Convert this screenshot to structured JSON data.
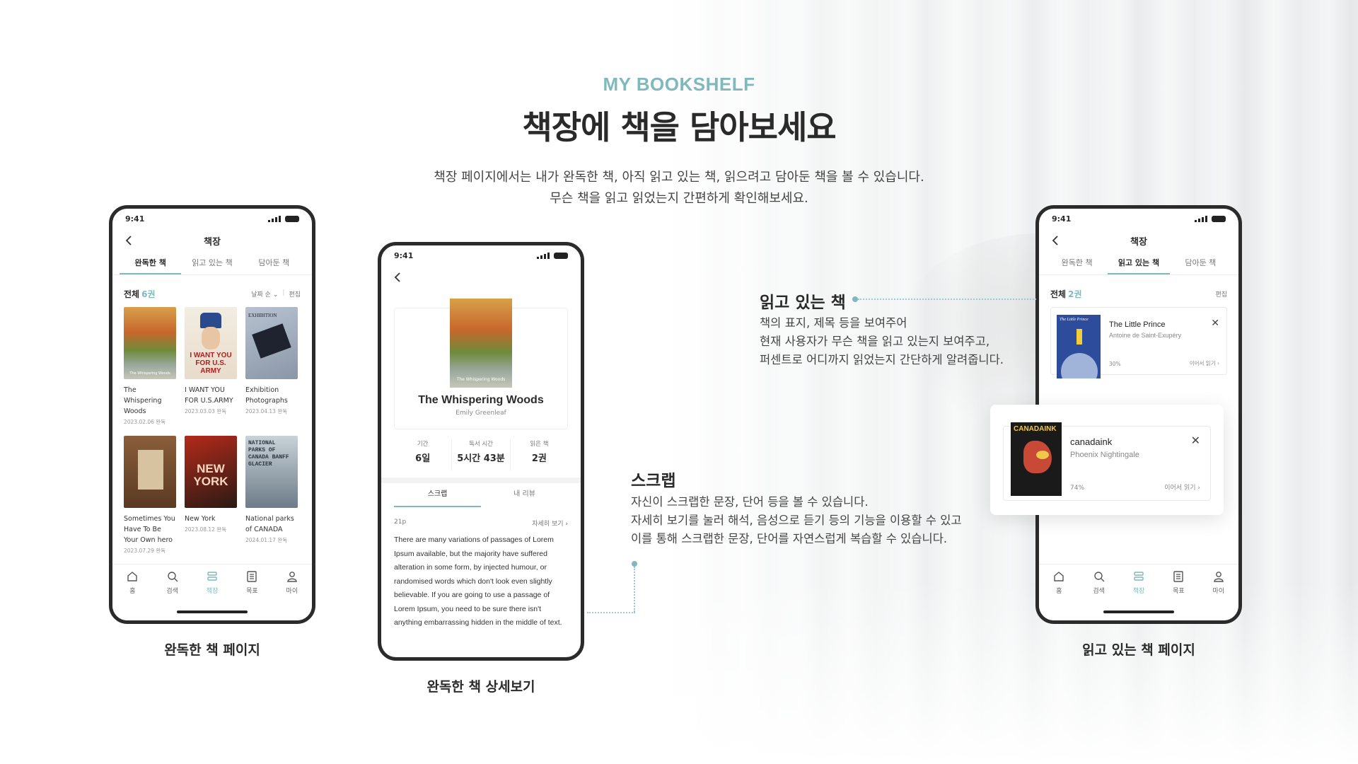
{
  "eyebrow": "MY BOOKSHELF",
  "headline": "책장에 책을 담아보세요",
  "lead": [
    "책장 페이지에서는 내가 완독한 책, 아직 읽고 있는 책, 읽으려고 담아둔 책을 볼 수 있습니다.",
    "무슨 책을 읽고 읽었는지 간편하게 확인해보세요."
  ],
  "accent": "#7fb9bd",
  "status_time": "9:41",
  "shelf": {
    "title": "책장",
    "tabs": [
      "완독한 책",
      "읽고 있는 책",
      "담아둔 책"
    ],
    "total_label": "전체",
    "finished_count": "6권",
    "reading_count": "2권",
    "sort": "날짜 순",
    "edit": "편집"
  },
  "books": [
    {
      "title": "The Whispering Woods",
      "date": "2023.02.06 완독",
      "cover_text": "The Whispering Woods"
    },
    {
      "title": "I WANT YOU FOR U.S.ARMY",
      "date": "2023.03.03 완독",
      "cover_text": "I WANT YOU FOR U.S. ARMY"
    },
    {
      "title": "Exhibition Photographs",
      "date": "2023.04.13 완독",
      "cover_text": "EXHIBITION"
    },
    {
      "title": "Sometimes You Have To Be Your Own hero",
      "date": "2023.07.29 완독",
      "cover_text": ""
    },
    {
      "title": "New York",
      "date": "2023.08.12 완독",
      "cover_text": "NEW YORK"
    },
    {
      "title": "National parks of CANADA",
      "date": "2024.01.17 완독",
      "cover_text": "NATIONAL PARKS OF CANADA BANFF GLACIER"
    }
  ],
  "nav": [
    "홈",
    "검색",
    "책장",
    "목표",
    "마이"
  ],
  "detail": {
    "title": "The Whispering Woods",
    "author": "Emily Greenleaf",
    "stats": [
      {
        "label": "기간",
        "value": "6일"
      },
      {
        "label": "독서 시간",
        "value": "5시간 43분"
      },
      {
        "label": "읽은 책",
        "value": "2권"
      }
    ],
    "tabs": [
      "스크랩",
      "내 리뷰"
    ],
    "page": "21p",
    "more": "자세히 보기",
    "scrap_text": "There are many variations of passages of Lorem Ipsum available, but the majority have suffered alteration in some form, by injected humour, or randomised words which don't look even slightly believable. If you are going to use a passage of Lorem Ipsum, you need to be sure there isn't anything embarrassing hidden in the middle of text."
  },
  "reading": [
    {
      "title": "The Little Prince",
      "author": "Antoine de Saint-Exupéry",
      "percent": "30%",
      "cover_text": "The Little Prince",
      "continue": "이어서 읽기"
    },
    {
      "title": "canadaink",
      "author": "Phoenix Nightingale",
      "percent": "74%",
      "cover_text": "CANADAINK",
      "continue": "이어서 읽기"
    }
  ],
  "notes": {
    "reading": {
      "title": "읽고 있는 책",
      "lines": [
        "책의 표지, 제목 등을 보여주어",
        "현재 사용자가 무슨 책을 읽고 있는지 보여주고,",
        "퍼센트로 어디까지 읽었는지 간단하게 알려줍니다."
      ]
    },
    "scrap": {
      "title": "스크랩",
      "lines": [
        "자신이 스크랩한 문장, 단어 등을 볼 수 있습니다.",
        "자세히 보기를 눌러 해석, 음성으로 듣기 등의 기능을 이용할 수 있고",
        "이를 통해 스크랩한 문장, 단어를 자연스럽게 복습할 수 있습니다."
      ]
    }
  },
  "captions": [
    "완독한 책 페이지",
    "완독한 책 상세보기",
    "읽고 있는 책 페이지"
  ]
}
